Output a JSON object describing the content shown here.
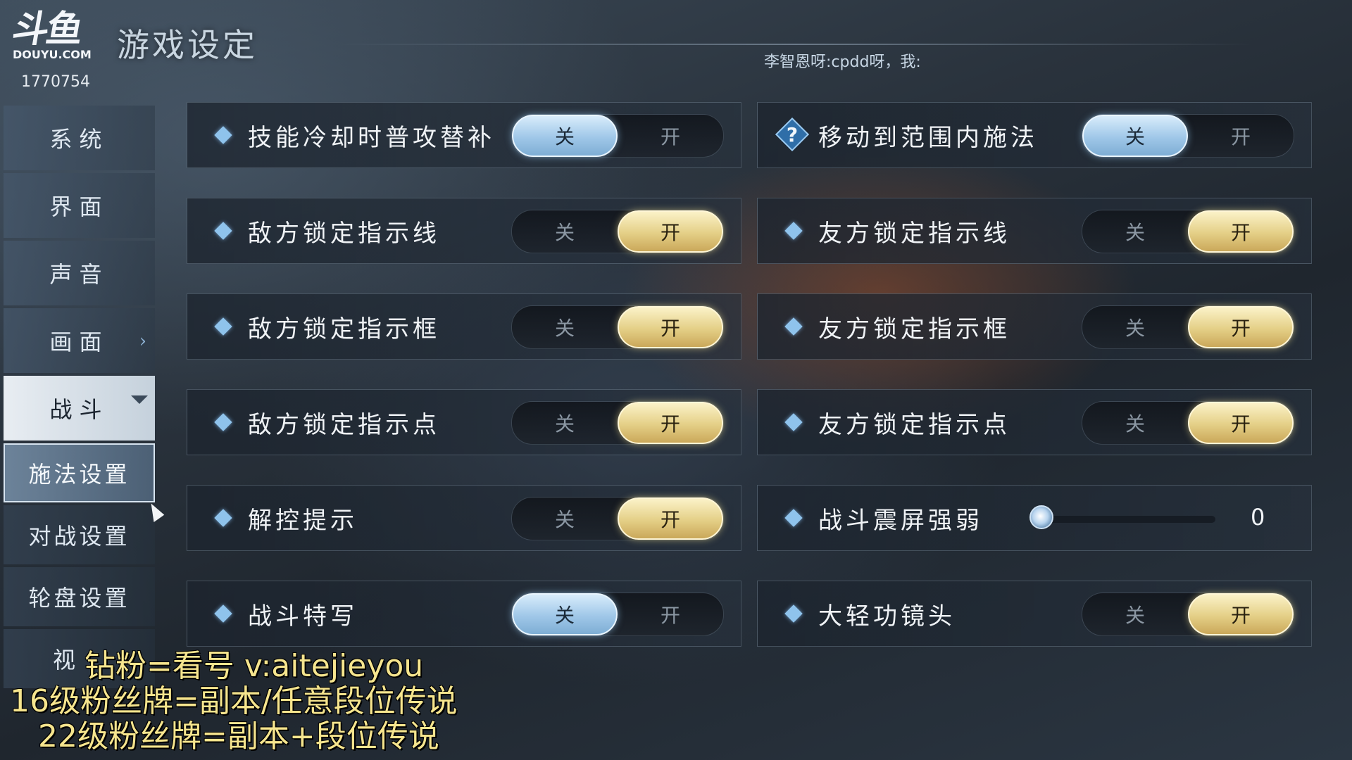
{
  "header": {
    "logo_main": "斗鱼",
    "logo_sub": "DOUYU.COM",
    "room_id": "1770754",
    "title": "游戏设定",
    "ticker": "李智恩呀:cpdd呀，我:"
  },
  "sidebar": {
    "items": [
      {
        "label": "系统"
      },
      {
        "label": "界面"
      },
      {
        "label": "声音"
      },
      {
        "label": "画面"
      },
      {
        "label": "战斗"
      }
    ],
    "sub_items": [
      {
        "label": "施法设置"
      },
      {
        "label": "对战设置"
      },
      {
        "label": "轮盘设置"
      },
      {
        "label": "视"
      }
    ]
  },
  "toggle_labels": {
    "off": "关",
    "on": "开"
  },
  "settings_left": [
    {
      "label": "技能冷却时普攻替补",
      "state": "off"
    },
    {
      "label": "敌方锁定指示线",
      "state": "on"
    },
    {
      "label": "敌方锁定指示框",
      "state": "on"
    },
    {
      "label": "敌方锁定指示点",
      "state": "on"
    },
    {
      "label": "解控提示",
      "state": "on"
    },
    {
      "label": "战斗特写",
      "state": "off"
    }
  ],
  "settings_right": [
    {
      "label": "移动到范围内施法",
      "state": "off",
      "help": "?"
    },
    {
      "label": "友方锁定指示线",
      "state": "on"
    },
    {
      "label": "友方锁定指示框",
      "state": "on"
    },
    {
      "label": "友方锁定指示点",
      "state": "on"
    },
    {
      "label": "战斗震屏强弱",
      "slider_value": "0"
    },
    {
      "label": "大轻功镜头",
      "state": "on"
    }
  ],
  "overlay": {
    "line1": "钻粉=看号  v:aitejieyou",
    "line2": "16级粉丝牌=副本/任意段位传说",
    "line3": "22级粉丝牌=副本+段位传说"
  },
  "colors": {
    "accent_off": "#9fc7e8",
    "accent_on": "#e4cf86",
    "diamond": "#8fc3ec",
    "overlay_text": "#f6e58e"
  }
}
